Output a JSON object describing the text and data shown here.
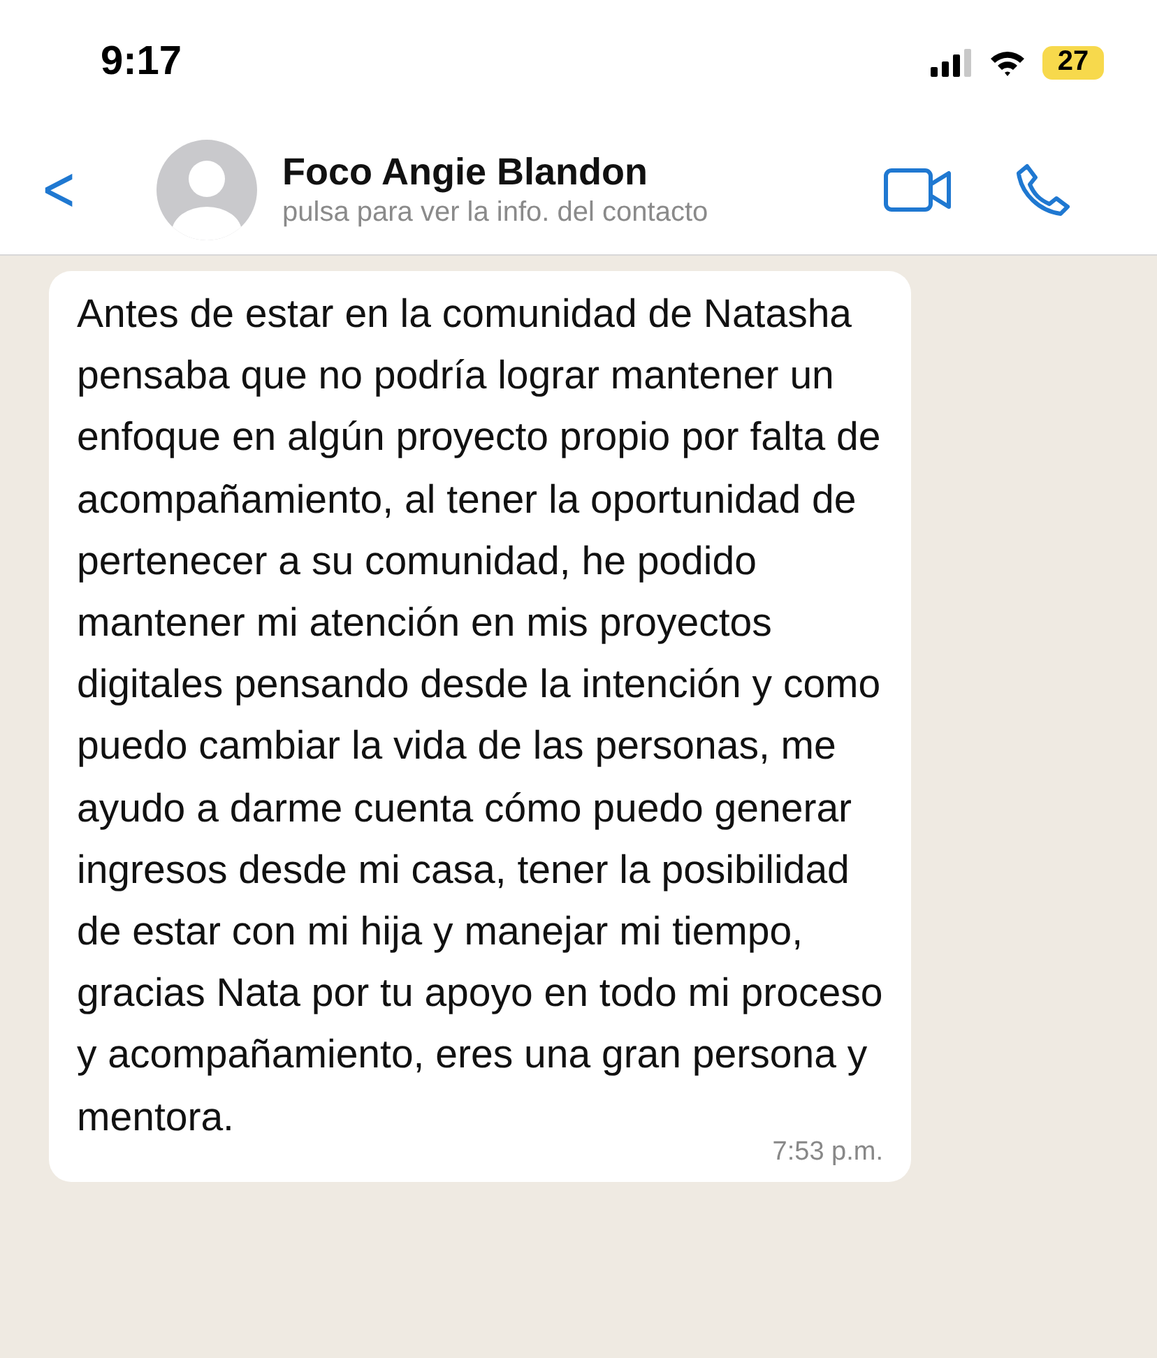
{
  "status_bar": {
    "time": "9:17",
    "battery": "27",
    "low_power": true
  },
  "header": {
    "back": "<",
    "name": "Foco Angie Blandon",
    "subtitle": "pulsa para ver la info. del contacto"
  },
  "messages": [
    {
      "text": "Antes de estar en la comunidad de Natasha pensaba que no podría lograr mantener un enfoque en algún proyecto propio por falta de acompañamiento, al tener la oportunidad de pertenecer a su comunidad, he podido mantener mi atención en mis proyectos digitales pensando desde la intención y como puedo cambiar la vida de las personas, me ayudo a darme cuenta cómo puedo generar ingresos desde mi casa, tener la posibilidad de estar con mi hija y manejar mi tiempo, gracias Nata por tu apoyo en todo mi proceso y acompañamiento, eres una gran persona y mentora.",
      "time": "7:53 p.m."
    }
  ]
}
